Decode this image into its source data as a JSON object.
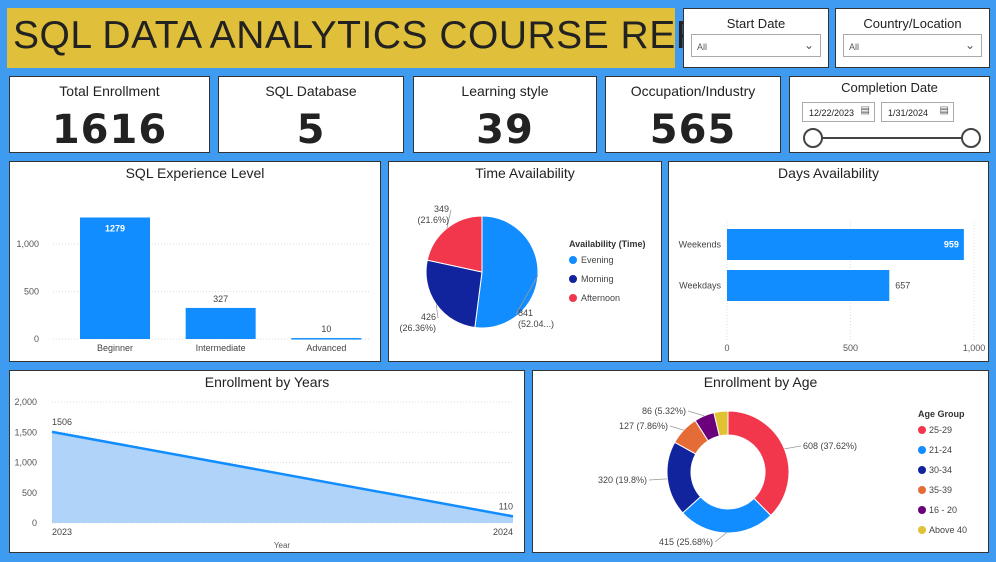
{
  "report": {
    "title": "SQL DATA ANALYTICS COURSE REPORT"
  },
  "slicers": {
    "start_date": {
      "label": "Start Date",
      "value": "All"
    },
    "country": {
      "label": "Country/Location",
      "value": "All"
    },
    "completion": {
      "label": "Completion Date",
      "from": "12/22/2023",
      "to": "1/31/2024"
    }
  },
  "kpis": [
    {
      "label": "Total Enrollment",
      "value": "1616"
    },
    {
      "label": "SQL Database",
      "value": "5"
    },
    {
      "label": "Learning style",
      "value": "39"
    },
    {
      "label": "Occupation/Industry",
      "value": "565"
    }
  ],
  "charts": {
    "sql_experience": {
      "title": "SQL Experience Level"
    },
    "time": {
      "title": "Time Availability",
      "legend_title": "Availability (Time)"
    },
    "days": {
      "title": "Days Availability"
    },
    "years": {
      "title": "Enrollment by Years",
      "xlabel": "Year"
    },
    "age": {
      "title": "Enrollment by Age",
      "legend_title": "Age Group"
    }
  },
  "colors": {
    "bar": "#118dff",
    "evening": "#118dff",
    "morning": "#12239e",
    "afternoon": "#f2374d",
    "area_line": "#118dff",
    "area_fill": "#a7cefa",
    "age_25_29": "#f2374d",
    "age_21_24": "#118dff",
    "age_30_34": "#12239e",
    "age_35_39": "#e66c37",
    "age_16_20": "#6b007b",
    "age_above_40": "#e1c233"
  },
  "chart_data": [
    {
      "type": "bar",
      "title": "SQL Experience Level",
      "categories": [
        "Beginner",
        "Intermediate",
        "Advanced"
      ],
      "values": [
        1279,
        327,
        10
      ],
      "data_labels": [
        "1279",
        "327",
        "10"
      ],
      "y_ticks": [
        "0",
        "500",
        "1,000"
      ],
      "ylim": [
        0,
        1400
      ],
      "grid": true
    },
    {
      "type": "pie",
      "title": "Time Availability",
      "legend_title": "Availability (Time)",
      "legend_placement": "right",
      "labels": [
        "Evening",
        "Morning",
        "Afternoon"
      ],
      "values": [
        841,
        426,
        349
      ],
      "data_labels": [
        [
          "841",
          "(52.04...)"
        ],
        [
          "426",
          "(26.36%)"
        ],
        [
          "349",
          "(21.6%)"
        ]
      ]
    },
    {
      "type": "bar",
      "orientation": "horizontal",
      "title": "Days Availability",
      "categories": [
        "Weekends",
        "Weekdays"
      ],
      "values": [
        959,
        657
      ],
      "data_labels": [
        "959",
        "657"
      ],
      "x_ticks": [
        "0",
        "500",
        "1,000"
      ],
      "xlim": [
        0,
        1000
      ],
      "grid": true
    },
    {
      "type": "area",
      "title": "Enrollment by Years",
      "xlabel": "Year",
      "x": [
        "2023",
        "2024"
      ],
      "values": [
        1506,
        110
      ],
      "data_labels": [
        "1506",
        "110"
      ],
      "y_ticks": [
        "0",
        "500",
        "1,000",
        "1,500",
        "2,000"
      ],
      "ylim": [
        0,
        2000
      ],
      "grid": true
    },
    {
      "type": "pie",
      "subtype": "donut",
      "title": "Enrollment by Age",
      "legend_title": "Age Group",
      "legend_placement": "right",
      "labels": [
        "25-29",
        "21-24",
        "30-34",
        "35-39",
        "16 - 20",
        "Above 40"
      ],
      "values": [
        608,
        415,
        320,
        127,
        86,
        60
      ],
      "data_labels": [
        "608 (37.62%)",
        "415 (25.68%)",
        "320 (19.8%)",
        "127 (7.86%)",
        "86 (5.32%)",
        ""
      ]
    }
  ]
}
